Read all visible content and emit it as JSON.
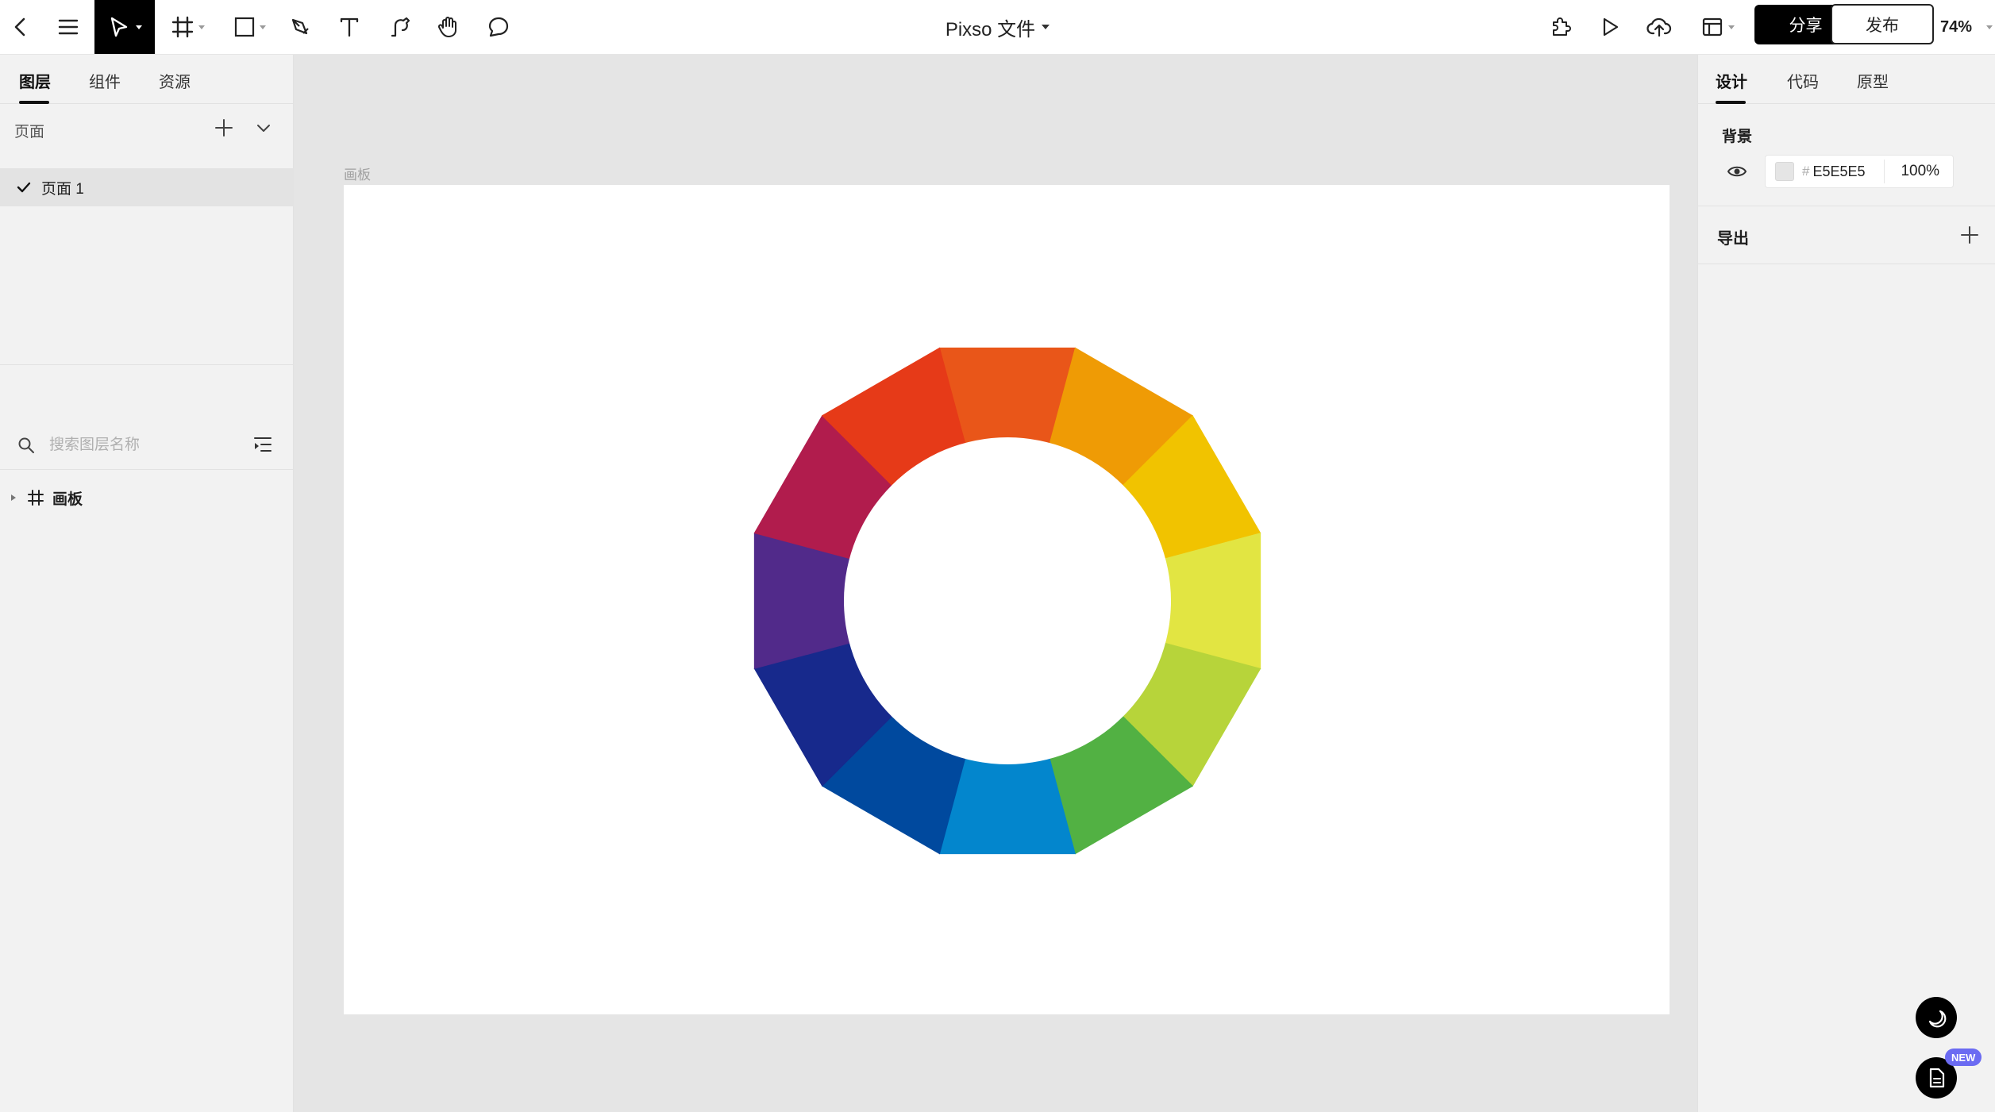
{
  "topbar": {
    "doc_title": "Pixso 文件",
    "share_label": "分享",
    "publish_label": "发布",
    "zoom_label": "74%"
  },
  "left_panel": {
    "tabs": [
      {
        "label": "图层",
        "active": true
      },
      {
        "label": "组件",
        "active": false
      },
      {
        "label": "资源",
        "active": false
      }
    ],
    "pages_title": "页面",
    "pages": [
      {
        "label": "页面 1",
        "selected": true
      }
    ],
    "search_placeholder": "搜索图层名称",
    "layers": [
      {
        "label": "画板",
        "type": "frame"
      }
    ]
  },
  "canvas": {
    "frame_label": "画板",
    "color_wheel": {
      "segments": [
        {
          "color": "#E95619"
        },
        {
          "color": "#EF9B05"
        },
        {
          "color": "#F1C300"
        },
        {
          "color": "#E2E542"
        },
        {
          "color": "#B7D43A"
        },
        {
          "color": "#52B143"
        },
        {
          "color": "#0386CD"
        },
        {
          "color": "#00499E"
        },
        {
          "color": "#17298C"
        },
        {
          "color": "#512A8A"
        },
        {
          "color": "#B11C4D"
        },
        {
          "color": "#E63A18"
        }
      ]
    }
  },
  "right_panel": {
    "tabs": [
      {
        "label": "设计",
        "active": true
      },
      {
        "label": "代码",
        "active": false
      },
      {
        "label": "原型",
        "active": false
      }
    ],
    "background": {
      "title": "背景",
      "hash": "#",
      "hex": "E5E5E5",
      "swatch_color": "#E5E5E5",
      "opacity": "100%"
    },
    "export_title": "导出",
    "new_badge": "NEW"
  }
}
